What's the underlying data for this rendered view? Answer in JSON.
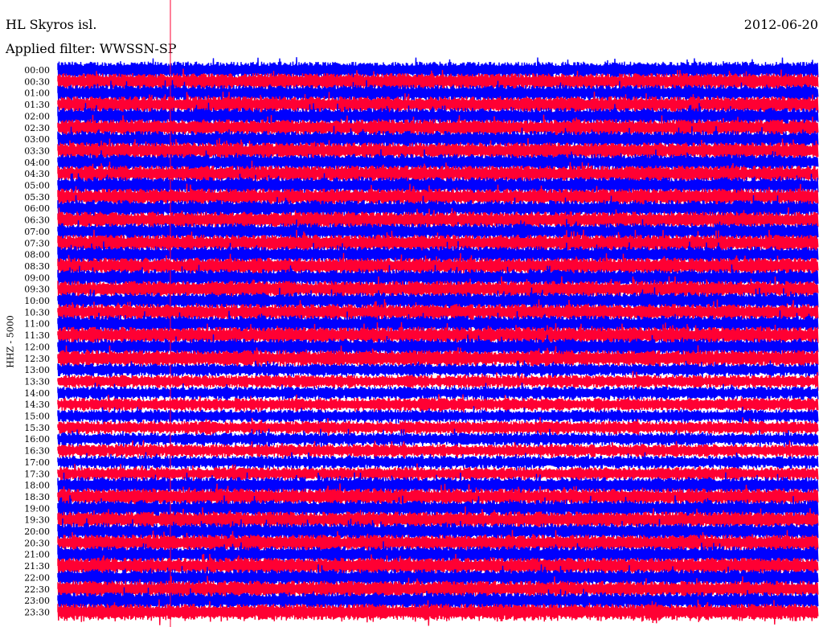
{
  "header": {
    "station": "HL Skyros isl.",
    "date": "2012-06-20",
    "filter": "Applied filter: WWSSN-SP"
  },
  "chart_data": {
    "type": "line",
    "title": "HL Skyros isl.",
    "ylabel": "HHZ - 5000",
    "row_labels": [
      "00:00",
      "00:30",
      "01:00",
      "01:30",
      "02:00",
      "02:30",
      "03:00",
      "03:30",
      "04:00",
      "04:30",
      "05:00",
      "05:30",
      "06:00",
      "06:30",
      "07:00",
      "07:30",
      "08:00",
      "08:30",
      "09:00",
      "09:30",
      "10:00",
      "10:30",
      "11:00",
      "11:30",
      "12:00",
      "12:30",
      "13:00",
      "13:30",
      "14:00",
      "14:30",
      "15:00",
      "15:30",
      "16:00",
      "16:30",
      "17:00",
      "17:30",
      "18:00",
      "18:30",
      "19:00",
      "19:30",
      "20:00",
      "20:30",
      "21:00",
      "21:30",
      "22:00",
      "22:30",
      "23:00",
      "23:30"
    ],
    "row_colors": [
      "#0000ff",
      "#ff0033"
    ],
    "colors": {
      "blue": "#0000ff",
      "red": "#ff0033",
      "marker": "#ff0033"
    }
  }
}
